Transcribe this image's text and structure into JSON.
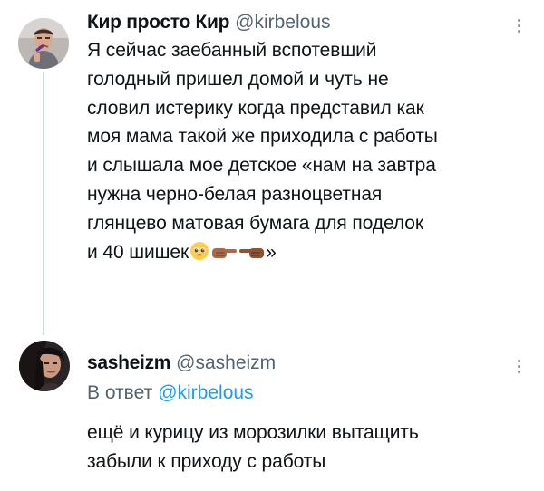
{
  "tweets": [
    {
      "author": {
        "display_name": "Кир просто Кир",
        "handle": "@kirbelous"
      },
      "text_lines": [
        "Я сейчас заебанный вспотевший",
        "голодный пришел домой и чуть не",
        "словил истерику когда представил как",
        "моя мама такой же приходила с работы",
        "и слышала мое детское «нам на завтра",
        "нужна черно-белая разноцветная",
        "глянцево матовая бумага для поделок",
        "и 40 шишек"
      ],
      "text_end": "»",
      "emojis": [
        "pleading-face-emoji",
        "backhand-index-pointing-right-emoji",
        "backhand-index-pointing-left-emoji"
      ]
    },
    {
      "author": {
        "display_name": "sasheizm",
        "handle": "@sasheizm"
      },
      "reply_to": {
        "prefix": "В ответ",
        "mention": "@kirbelous"
      },
      "text_lines": [
        "ещё и курицу из морозилки вытащить",
        "забыли к приходу с работы"
      ]
    }
  ],
  "colors": {
    "text": "#0f1419",
    "secondary": "#536471",
    "link": "#1d9bf0",
    "thread_line": "#cfd9de"
  },
  "icons": [
    "more-icon",
    "avatar"
  ]
}
